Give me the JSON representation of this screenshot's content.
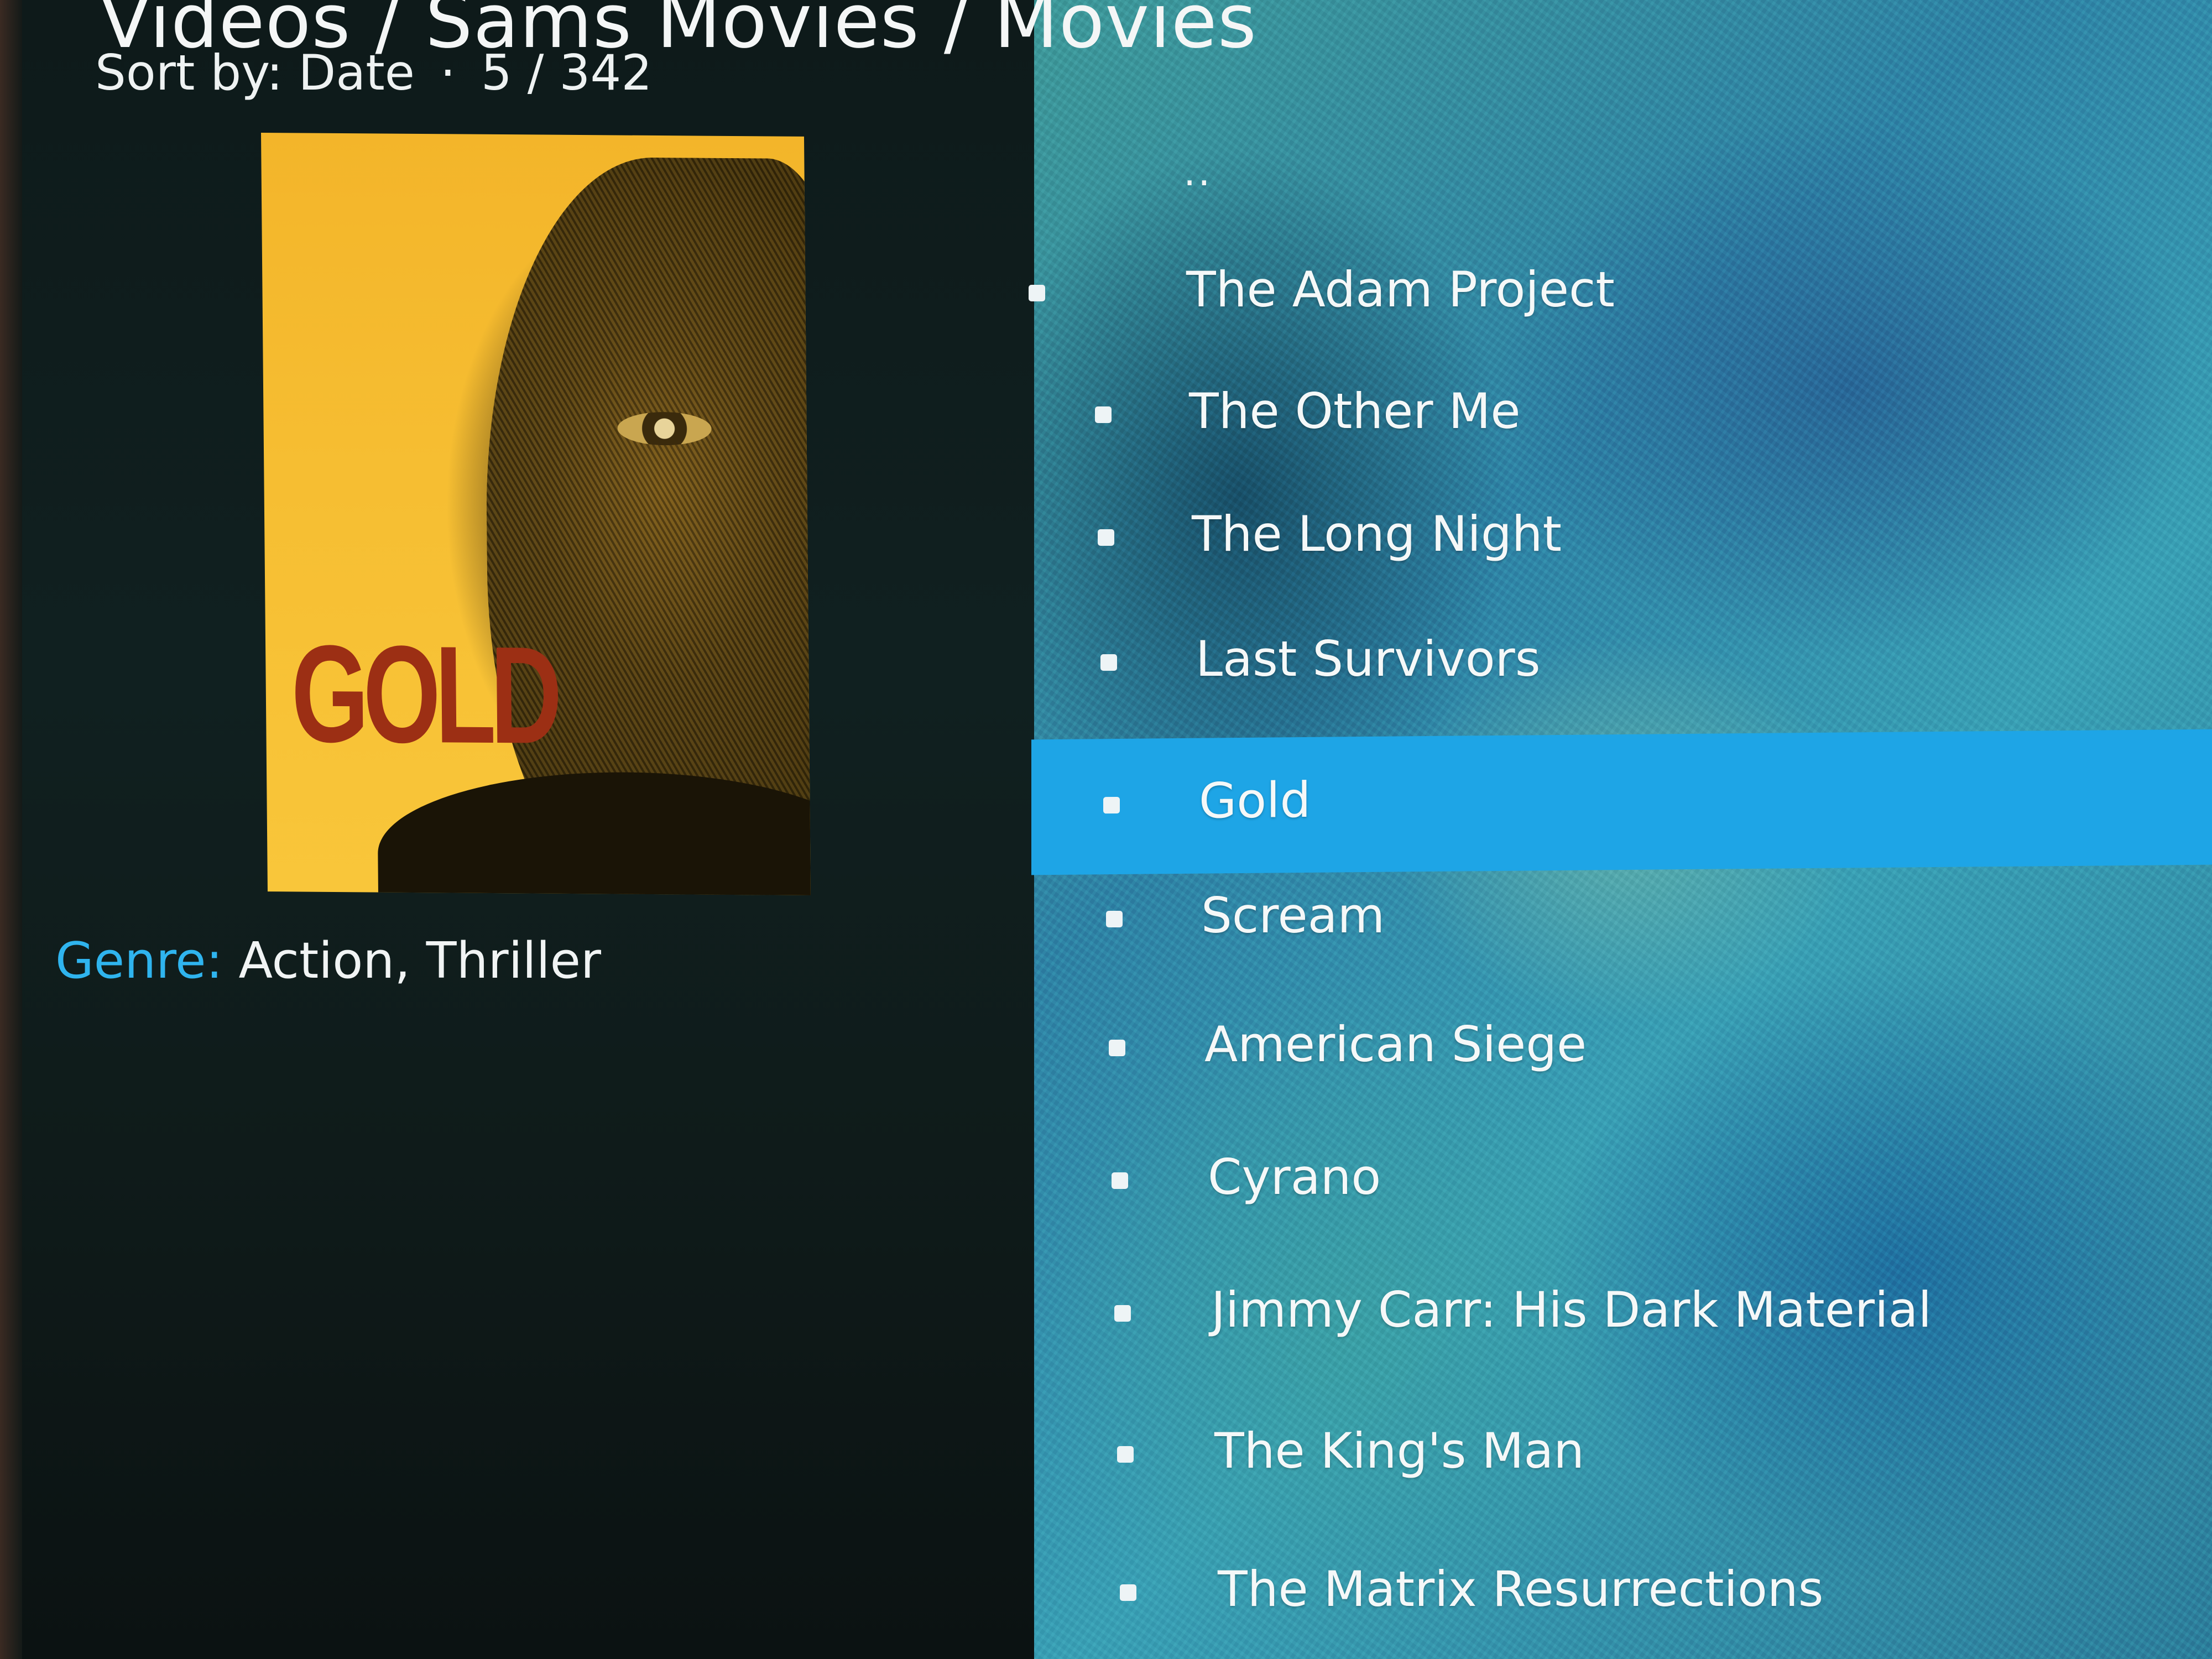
{
  "header": {
    "breadcrumb": "Videos / Sams Movies / Movies",
    "sort_label": "Sort by: Date",
    "separator": "·",
    "position": "5 / 342"
  },
  "poster": {
    "title_text": "GOLD"
  },
  "details": {
    "genre_label": "Genre:",
    "genre_value": "Action, Thriller"
  },
  "list": {
    "parent_item": "..",
    "items": [
      {
        "label": "The Adam Project"
      },
      {
        "label": "The Other Me"
      },
      {
        "label": "The Long Night"
      },
      {
        "label": "Last Survivors"
      },
      {
        "label": "Gold"
      },
      {
        "label": "Scream"
      },
      {
        "label": "American Siege"
      },
      {
        "label": "Cyrano"
      },
      {
        "label": "Jimmy Carr: His Dark Material"
      },
      {
        "label": "The King's Man"
      },
      {
        "label": "The Matrix Resurrections"
      }
    ],
    "selected_index": 4
  },
  "colors": {
    "accent": "#1ea5e6",
    "genre_label": "#2fb4ee",
    "panel_bg": "#0f1b1a",
    "poster_bg": "#f6be32",
    "poster_title": "#9c2f14"
  }
}
